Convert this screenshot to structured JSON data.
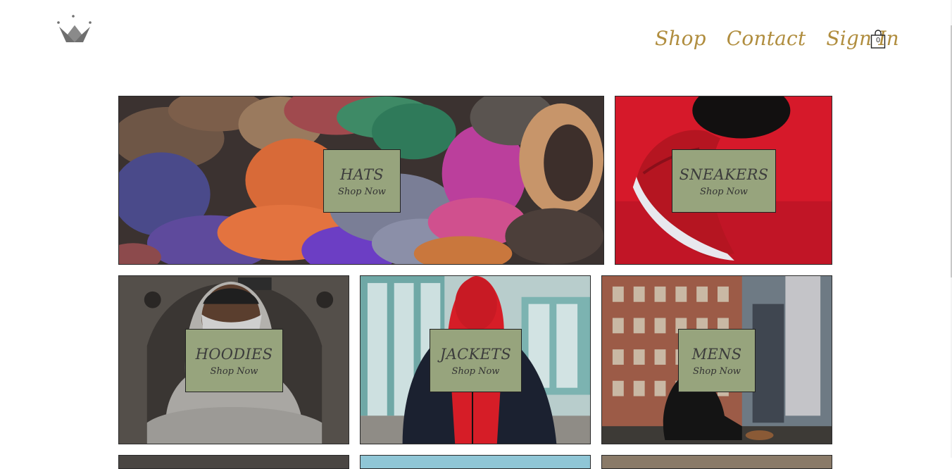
{
  "nav": {
    "shop": "Shop",
    "contact": "Contact",
    "signin": "Sign In"
  },
  "cart": {
    "count": "0"
  },
  "tiles": [
    {
      "title": "HATS",
      "cta": "Shop Now"
    },
    {
      "title": "SNEAKERS",
      "cta": "Shop Now"
    },
    {
      "title": "HOODIES",
      "cta": "Shop Now"
    },
    {
      "title": "JACKETS",
      "cta": "Shop Now"
    },
    {
      "title": "MENS",
      "cta": "Shop Now"
    }
  ],
  "colors": {
    "nav_text": "#b08d3e",
    "label_bg": "#97a47d",
    "logo": "#6f6f6f"
  },
  "icons": {
    "logo": "crown-icon",
    "cart": "shopping-bag-icon"
  }
}
